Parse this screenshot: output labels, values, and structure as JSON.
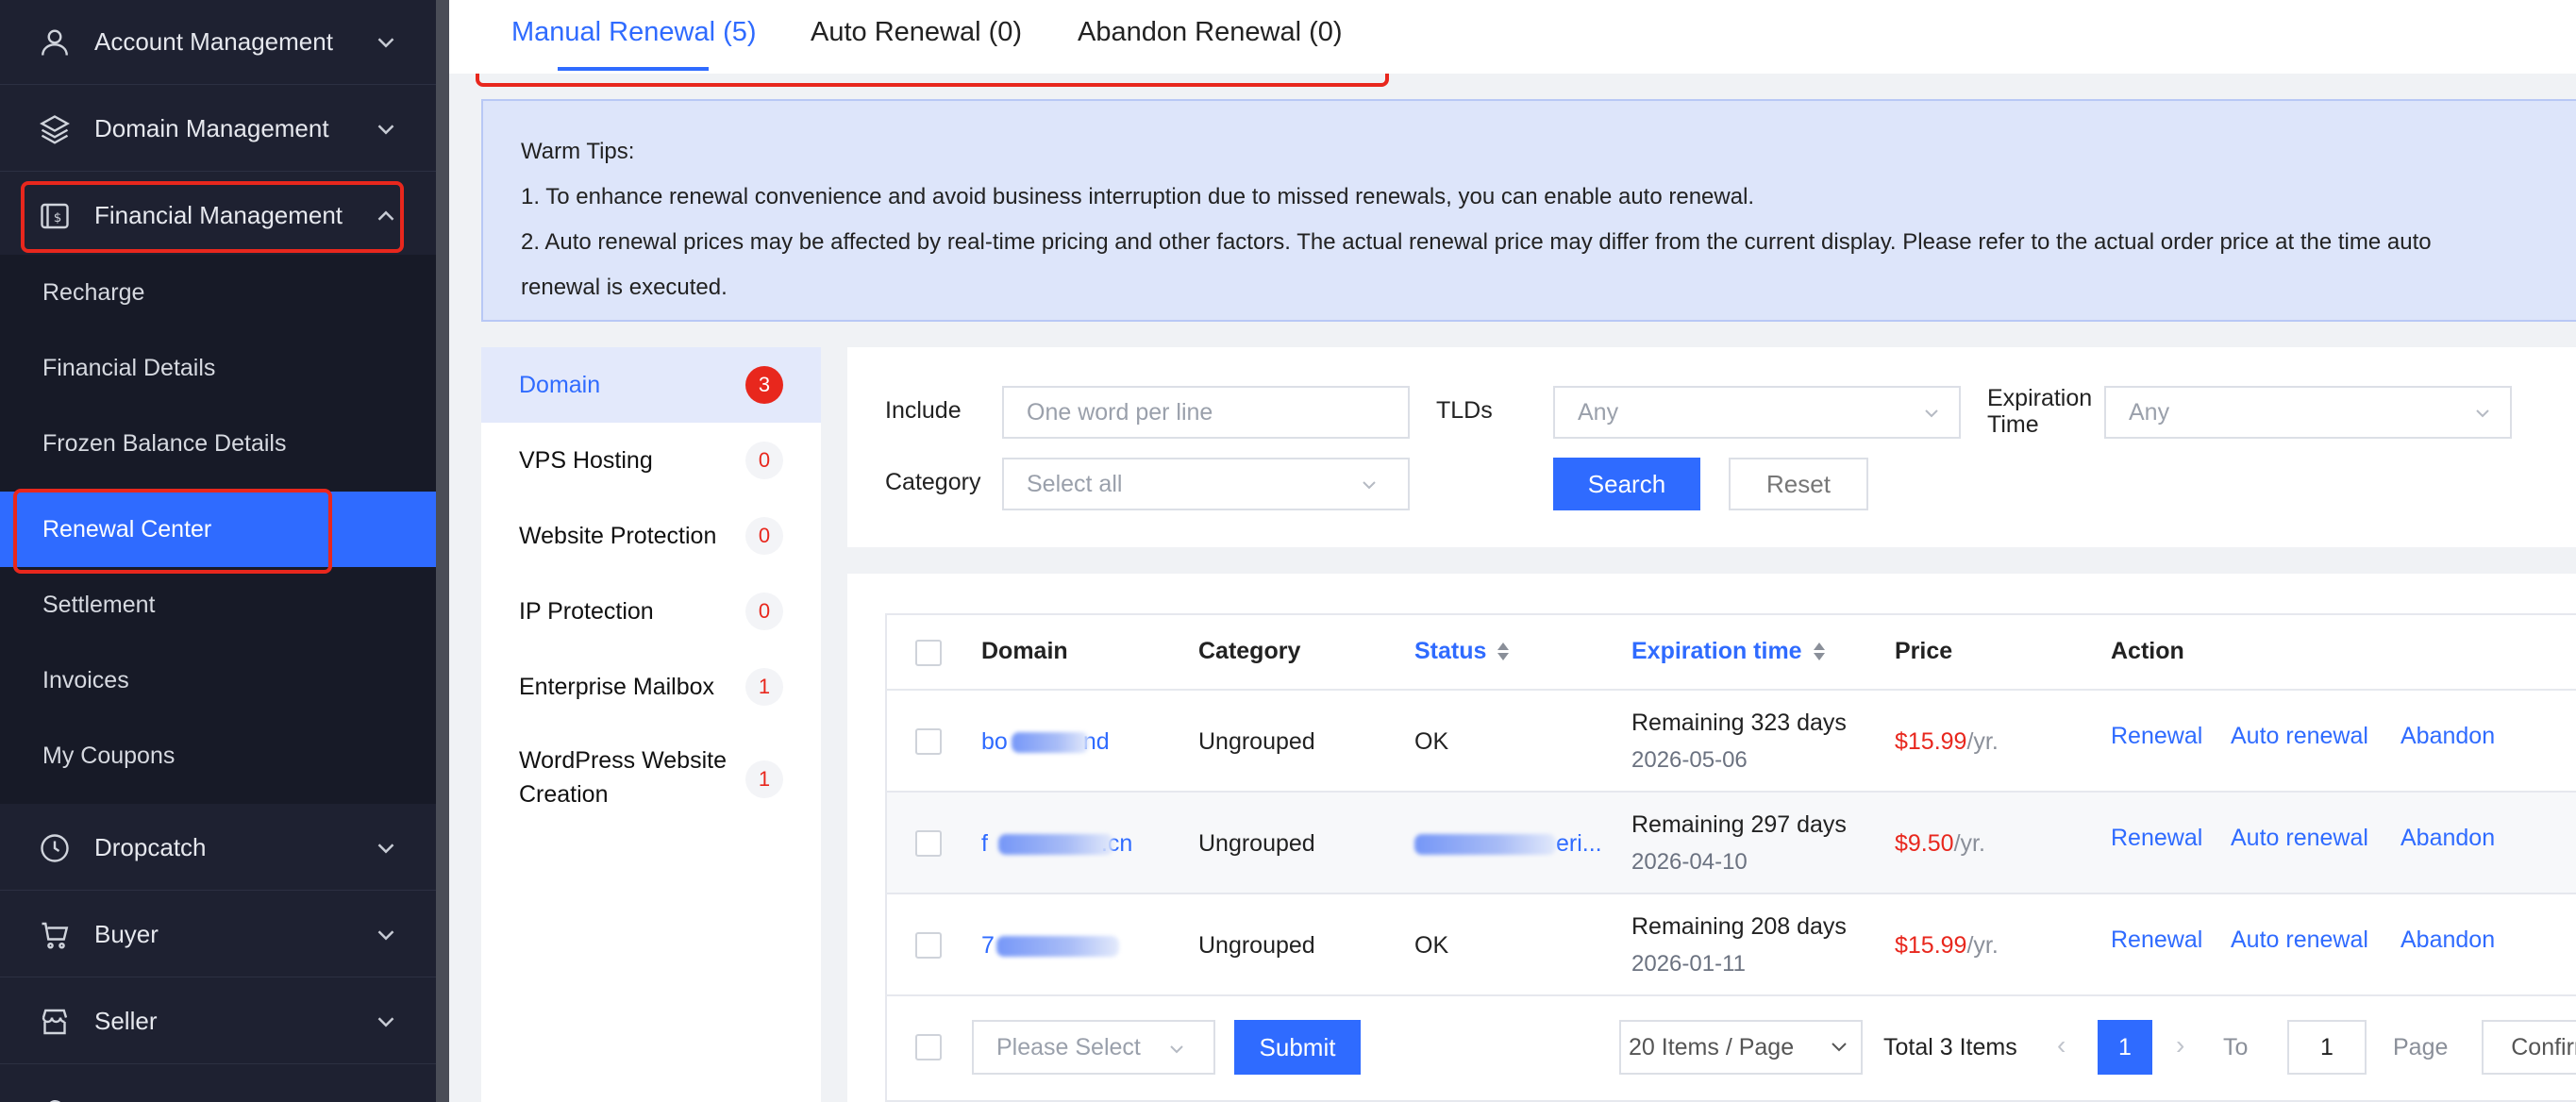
{
  "sidebar": {
    "groups_top": [
      {
        "label": "Account Management",
        "icon": "user-icon"
      },
      {
        "label": "Domain Management",
        "icon": "layers-icon"
      },
      {
        "label": "Financial Management",
        "icon": "dollar-wallet-icon"
      }
    ],
    "sub_items": [
      {
        "label": "Recharge"
      },
      {
        "label": "Financial Details"
      },
      {
        "label": "Frozen Balance Details"
      },
      {
        "label": "Renewal Center"
      },
      {
        "label": "Settlement"
      },
      {
        "label": "Invoices"
      },
      {
        "label": "My Coupons"
      }
    ],
    "groups_bottom": [
      {
        "label": "Dropcatch",
        "icon": "clock-icon"
      },
      {
        "label": "Buyer",
        "icon": "cart-icon"
      },
      {
        "label": "Seller",
        "icon": "store-icon"
      }
    ]
  },
  "tabs": [
    {
      "label": "Manual Renewal (5)"
    },
    {
      "label": "Auto Renewal (0)"
    },
    {
      "label": "Abandon Renewal (0)"
    }
  ],
  "tips": {
    "title": "Warm Tips:",
    "line1": "1. To enhance renewal convenience and avoid business interruption due to missed renewals, you can enable auto renewal.",
    "line2": "2. Auto renewal prices may be affected by real-time pricing and other factors. The actual renewal price may differ from the current display. Please refer to the actual order price at the time auto",
    "line3": "renewal is executed."
  },
  "categories": [
    {
      "label": "Domain",
      "count": "3"
    },
    {
      "label": "VPS Hosting",
      "count": "0"
    },
    {
      "label": "Website Protection",
      "count": "0"
    },
    {
      "label": "IP Protection",
      "count": "0"
    },
    {
      "label": "Enterprise Mailbox",
      "count": "1"
    },
    {
      "label": "WordPress Website Creation",
      "count": "1"
    }
  ],
  "filters": {
    "include_label": "Include",
    "include_placeholder": "One word per line",
    "tlds_label": "TLDs",
    "tlds_value": "Any",
    "expiration_label": "Expiration Time",
    "expiration_value": "Any",
    "category_label": "Category",
    "category_value": "Select all",
    "search_label": "Search",
    "reset_label": "Reset"
  },
  "table": {
    "headers": {
      "domain": "Domain",
      "category": "Category",
      "status": "Status",
      "expiration": "Expiration time",
      "price": "Price",
      "action": "Action"
    },
    "rows": [
      {
        "domain_start": "bo",
        "domain_end": "nd",
        "category": "Ungrouped",
        "status": "OK",
        "remaining": "Remaining 323 days",
        "date": "2026-05-06",
        "price": "$15.99",
        "unit": "/yr."
      },
      {
        "domain_start": "f",
        "domain_end": ".cn",
        "category": "Ungrouped",
        "status": "",
        "status_end": "eri...",
        "remaining": "Remaining 297 days",
        "date": "2026-04-10",
        "price": "$9.50",
        "unit": "/yr."
      },
      {
        "domain_start": "7",
        "domain_end": "",
        "category": "Ungrouped",
        "status": "OK",
        "remaining": "Remaining 208 days",
        "date": "2026-01-11",
        "price": "$15.99",
        "unit": "/yr."
      }
    ],
    "actions": {
      "renewal": "Renewal",
      "auto_renewal": "Auto renewal",
      "abandon": "Abandon"
    },
    "footer": {
      "bulk_placeholder": "Please Select",
      "submit_label": "Submit",
      "page_size": "20 Items / Page",
      "total": "Total 3 Items",
      "current_page": "1",
      "to_label": "To",
      "goto_value": "1",
      "page_label": "Page",
      "confirm_label": "Confirm"
    }
  },
  "colors": {
    "accent": "#2f6bff",
    "sidebar_bg": "#1e2131",
    "highlight": "#e8271d",
    "price": "#e8271d"
  }
}
